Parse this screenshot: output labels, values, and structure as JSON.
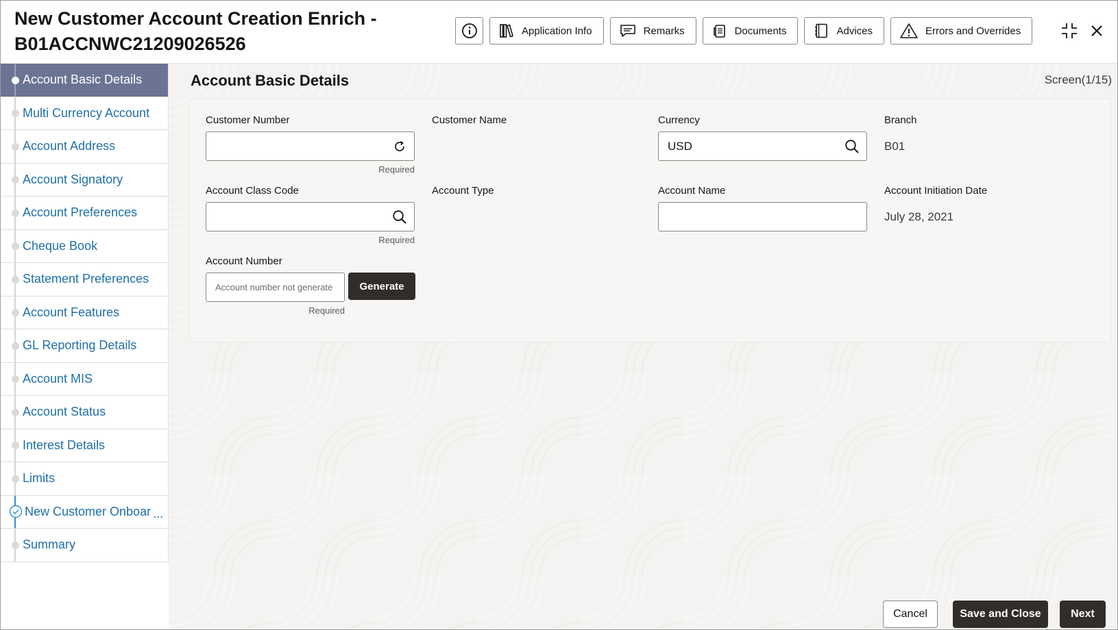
{
  "header": {
    "title_line1": "New Customer Account Creation Enrich -",
    "title_line2": "B01ACCNWC21209026526",
    "toolbar": {
      "application_info": "Application Info",
      "remarks": "Remarks",
      "documents": "Documents",
      "advices": "Advices",
      "errors_overrides": "Errors and Overrides"
    }
  },
  "sidebar": {
    "items": [
      {
        "label": "Account Basic Details"
      },
      {
        "label": "Multi Currency Account"
      },
      {
        "label": "Account Address"
      },
      {
        "label": "Account Signatory"
      },
      {
        "label": "Account Preferences"
      },
      {
        "label": "Cheque Book"
      },
      {
        "label": "Statement Preferences"
      },
      {
        "label": "Account Features"
      },
      {
        "label": "GL Reporting Details"
      },
      {
        "label": "Account MIS"
      },
      {
        "label": "Account Status"
      },
      {
        "label": "Interest Details"
      },
      {
        "label": "Limits"
      },
      {
        "label": "New Customer Onboar",
        "ellipsis": "..."
      },
      {
        "label": "Summary"
      }
    ]
  },
  "main": {
    "title": "Account Basic Details",
    "screen_counter": "Screen(1/15)",
    "fields": {
      "customer_number": {
        "label": "Customer Number",
        "value": "",
        "required": "Required"
      },
      "customer_name": {
        "label": "Customer Name"
      },
      "currency": {
        "label": "Currency",
        "value": "USD"
      },
      "branch": {
        "label": "Branch",
        "value": "B01"
      },
      "account_class_code": {
        "label": "Account Class Code",
        "value": "",
        "required": "Required"
      },
      "account_type": {
        "label": "Account Type"
      },
      "account_name": {
        "label": "Account Name",
        "value": ""
      },
      "account_initiation_date": {
        "label": "Account Initiation Date",
        "value": "July 28, 2021"
      },
      "account_number": {
        "label": "Account Number",
        "placeholder": "Account number not generate",
        "required": "Required",
        "generate_label": "Generate"
      }
    }
  },
  "footer": {
    "cancel": "Cancel",
    "save_close": "Save and Close",
    "next": "Next"
  }
}
